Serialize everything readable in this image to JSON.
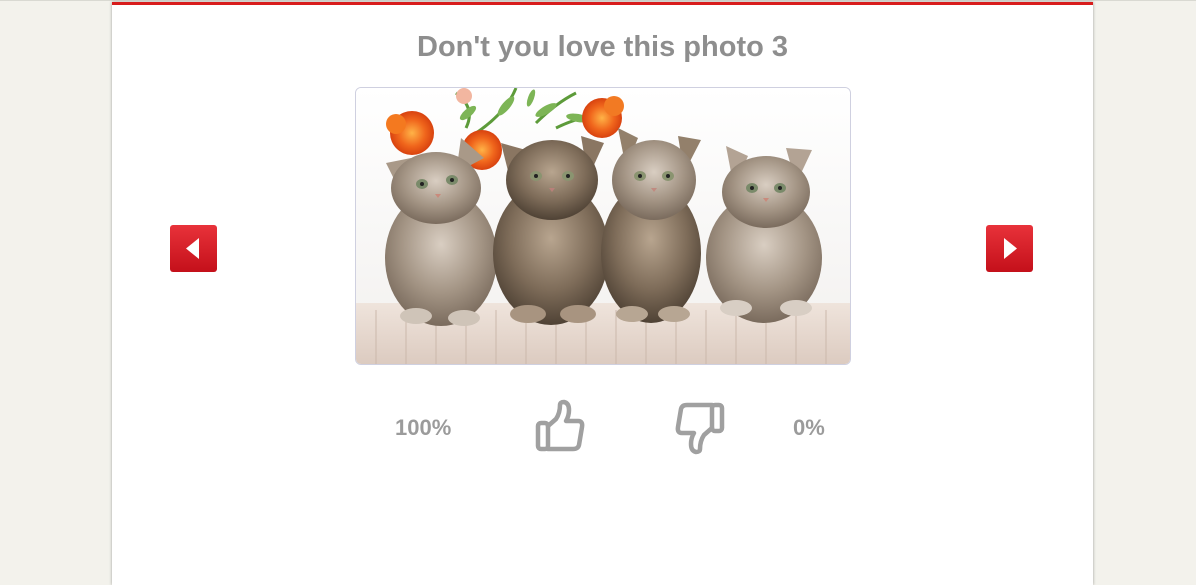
{
  "page": {
    "title": "Don't you love this photo 3",
    "accent_color": "#d81c1c"
  },
  "carousel": {
    "prev_icon": "caret-left-icon",
    "next_icon": "caret-right-icon",
    "photo_alt": "Four fluffy tabby kittens sitting in a row with orange flowers behind them"
  },
  "votes": {
    "like_percent": "100%",
    "dislike_percent": "0%",
    "like_icon": "thumbs-up-icon",
    "dislike_icon": "thumbs-down-icon"
  }
}
